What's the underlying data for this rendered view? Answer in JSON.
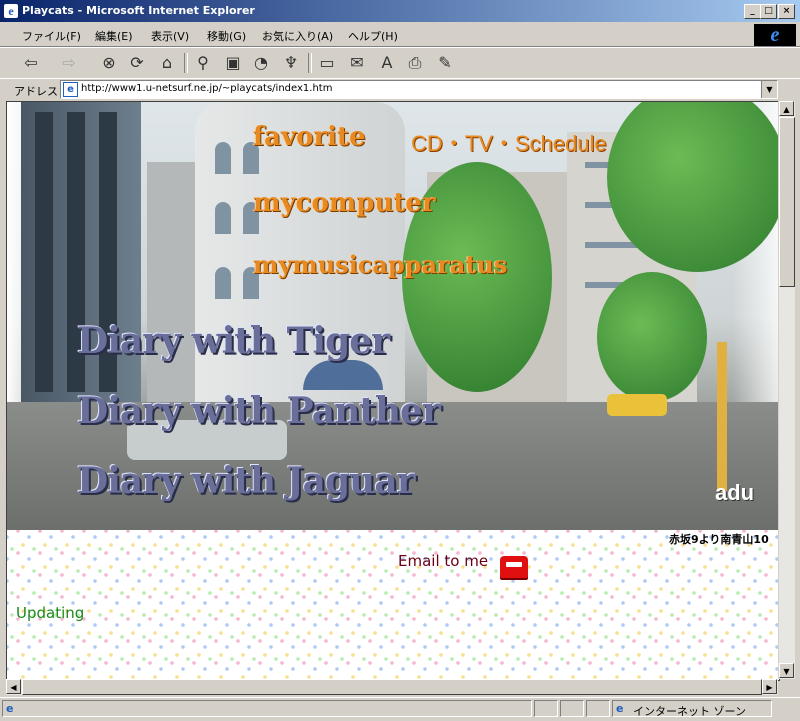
{
  "window": {
    "title": "Playcats - Microsoft Internet Explorer"
  },
  "menu": [
    "ファイル(F)",
    "編集(E)",
    "表示(V)",
    "移動(G)",
    "お気に入り(A)",
    "ヘルプ(H)"
  ],
  "toolbar": {
    "icons": [
      "back-icon",
      "forward-icon",
      "stop-icon",
      "refresh-icon",
      "home-icon",
      "search-icon",
      "favorites-icon",
      "history-icon",
      "channels-icon",
      "fullscreen-icon",
      "mail-icon",
      "font-icon",
      "print-icon",
      "edit-icon"
    ]
  },
  "address": {
    "label": "アドレス",
    "url": "http://www1.u-netsurf.ne.jp/~playcats/index1.htm"
  },
  "page": {
    "nav": {
      "favorite": "favorite",
      "cd_tv": "CD・TV・Schedule",
      "computer": "mycomputer",
      "music": "mymusicapparatus"
    },
    "diaries": [
      "Diary with Tiger",
      "Diary with Panther",
      "Diary with Jaguar"
    ],
    "photo_badge": "adu",
    "caption": "赤坂9より南青山10",
    "email": "Email to me",
    "updating": "Updating"
  },
  "status": {
    "zone": "インターネット ゾーン"
  }
}
